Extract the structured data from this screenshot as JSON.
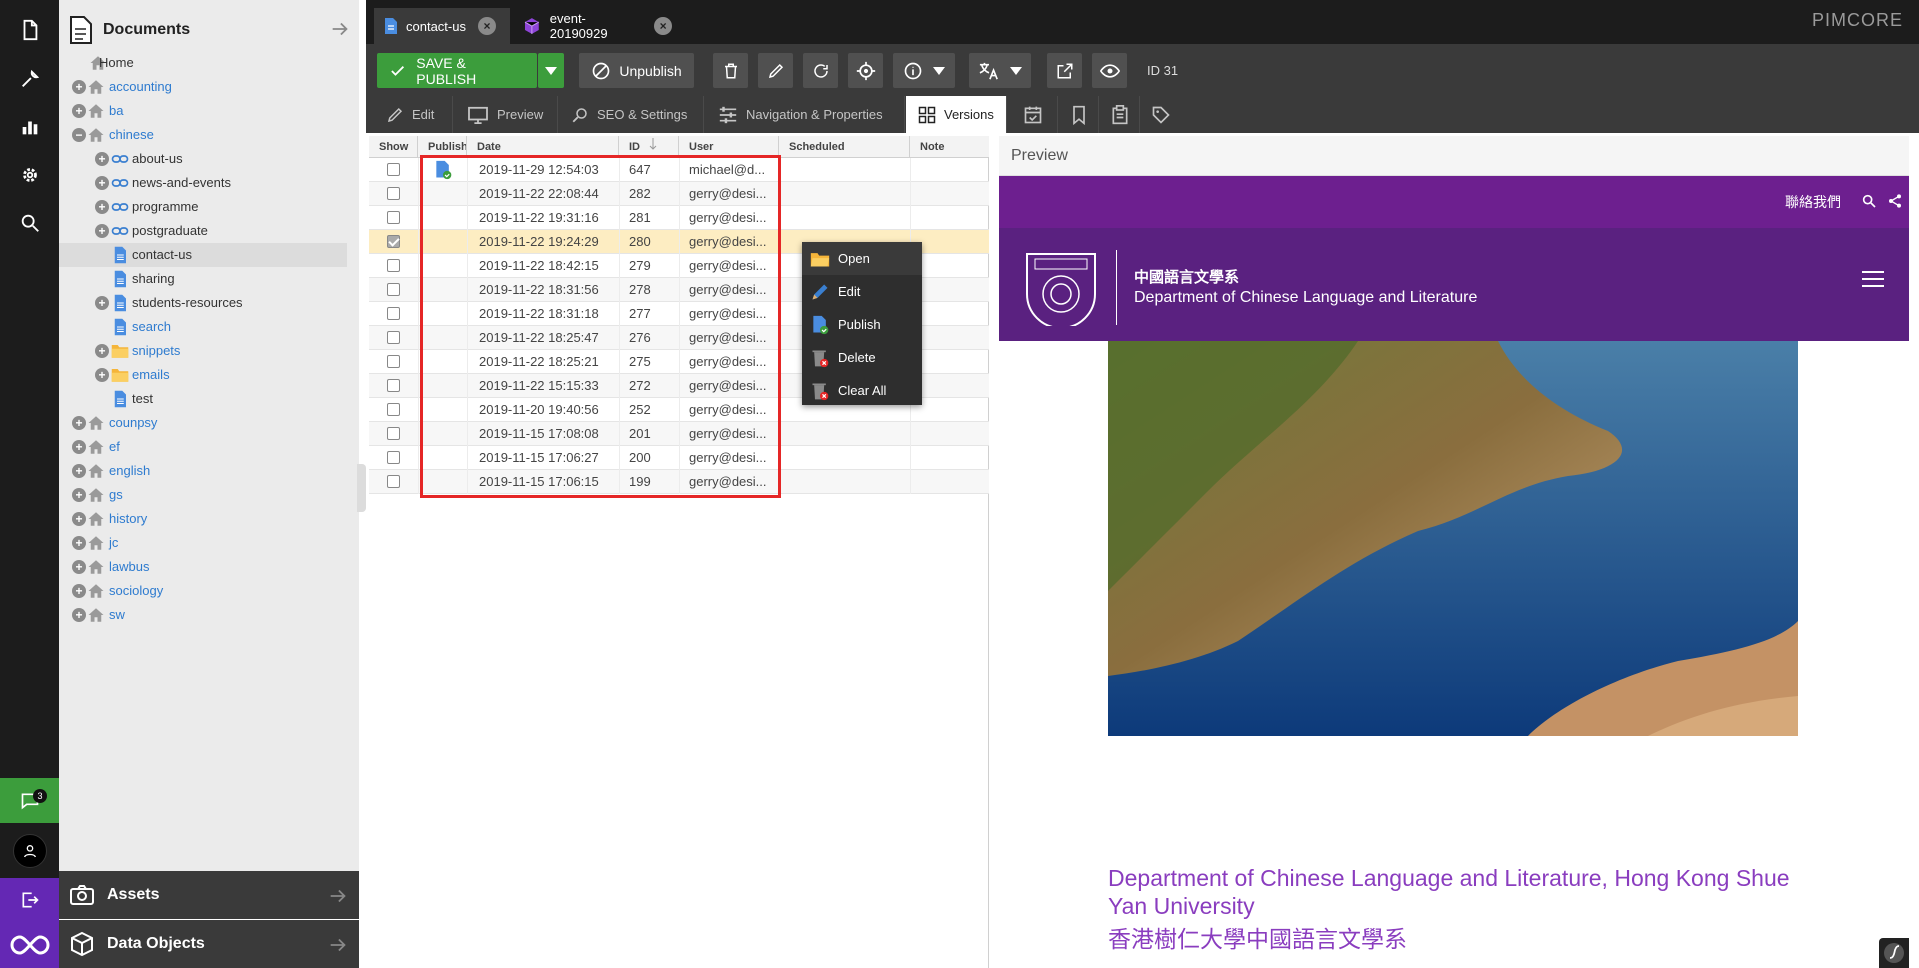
{
  "app": {
    "brand": "PIMCORE"
  },
  "rail": {
    "icons": [
      "file-icon",
      "tools-icon",
      "chart-icon",
      "gear-icon",
      "search-icon"
    ],
    "chat_count": "3"
  },
  "tree": {
    "title": "Documents",
    "items": [
      {
        "label": "Home",
        "depth": 0,
        "icon": "home",
        "toggle": "none",
        "style": "dark"
      },
      {
        "label": "accounting",
        "depth": 1,
        "icon": "home",
        "toggle": "plus",
        "style": "link"
      },
      {
        "label": "ba",
        "depth": 1,
        "icon": "home",
        "toggle": "plus",
        "style": "link"
      },
      {
        "label": "chinese",
        "depth": 1,
        "icon": "home",
        "toggle": "minus",
        "style": "link"
      },
      {
        "label": "about-us",
        "depth": 2,
        "icon": "link",
        "toggle": "plus",
        "style": "dark"
      },
      {
        "label": "news-and-events",
        "depth": 2,
        "icon": "link",
        "toggle": "plus",
        "style": "dark"
      },
      {
        "label": "programme",
        "depth": 2,
        "icon": "link",
        "toggle": "plus",
        "style": "dark"
      },
      {
        "label": "postgraduate",
        "depth": 2,
        "icon": "link",
        "toggle": "plus",
        "style": "dark"
      },
      {
        "label": "contact-us",
        "depth": 2,
        "icon": "page",
        "toggle": "none",
        "style": "dark",
        "selected": true
      },
      {
        "label": "sharing",
        "depth": 2,
        "icon": "page",
        "toggle": "none",
        "style": "dark"
      },
      {
        "label": "students-resources",
        "depth": 2,
        "icon": "page",
        "toggle": "plus",
        "style": "dark"
      },
      {
        "label": "search",
        "depth": 2,
        "icon": "page",
        "toggle": "none",
        "style": "link"
      },
      {
        "label": "snippets",
        "depth": 2,
        "icon": "folder",
        "toggle": "plus",
        "style": "link"
      },
      {
        "label": "emails",
        "depth": 2,
        "icon": "folder",
        "toggle": "plus",
        "style": "link"
      },
      {
        "label": "test",
        "depth": 2,
        "icon": "page",
        "toggle": "none",
        "style": "dark"
      },
      {
        "label": "counpsy",
        "depth": 1,
        "icon": "home",
        "toggle": "plus",
        "style": "link"
      },
      {
        "label": "ef",
        "depth": 1,
        "icon": "home",
        "toggle": "plus",
        "style": "link"
      },
      {
        "label": "english",
        "depth": 1,
        "icon": "home",
        "toggle": "plus",
        "style": "link"
      },
      {
        "label": "gs",
        "depth": 1,
        "icon": "home",
        "toggle": "plus",
        "style": "link"
      },
      {
        "label": "history",
        "depth": 1,
        "icon": "home",
        "toggle": "plus",
        "style": "link"
      },
      {
        "label": "jc",
        "depth": 1,
        "icon": "home",
        "toggle": "plus",
        "style": "link"
      },
      {
        "label": "lawbus",
        "depth": 1,
        "icon": "home",
        "toggle": "plus",
        "style": "link"
      },
      {
        "label": "sociology",
        "depth": 1,
        "icon": "home",
        "toggle": "plus",
        "style": "link"
      },
      {
        "label": "sw",
        "depth": 1,
        "icon": "home",
        "toggle": "plus",
        "style": "link"
      }
    ]
  },
  "bottom_panels": {
    "assets": "Assets",
    "data_objects": "Data Objects"
  },
  "tabs": [
    {
      "label": "contact-us",
      "active": true
    },
    {
      "label": "event-20190929",
      "active": false
    }
  ],
  "toolbar": {
    "save_publish": "SAVE & PUBLISH",
    "unpublish": "Unpublish",
    "doc_id": "ID 31"
  },
  "subtabs": [
    {
      "label": "Edit",
      "icon": "pencil-icon"
    },
    {
      "label": "Preview",
      "icon": "monitor-icon"
    },
    {
      "label": "SEO & Settings",
      "icon": "seo-search-icon"
    },
    {
      "label": "Navigation & Properties",
      "icon": "sliders-icon"
    },
    {
      "label": "Versions",
      "icon": "grid-icon",
      "active": true
    }
  ],
  "versions": {
    "columns": [
      "Show",
      "Publish",
      "Date",
      "ID",
      "User",
      "Scheduled",
      "Note"
    ],
    "rows": [
      {
        "show": false,
        "published": true,
        "date": "2019-11-29 12:54:03",
        "id": "647",
        "user": "michael@d..."
      },
      {
        "show": false,
        "published": false,
        "date": "2019-11-22 22:08:44",
        "id": "282",
        "user": "gerry@desi..."
      },
      {
        "show": false,
        "published": false,
        "date": "2019-11-22 19:31:16",
        "id": "281",
        "user": "gerry@desi..."
      },
      {
        "show": true,
        "published": false,
        "date": "2019-11-22 19:24:29",
        "id": "280",
        "user": "gerry@desi...",
        "highlight": true
      },
      {
        "show": false,
        "published": false,
        "date": "2019-11-22 18:42:15",
        "id": "279",
        "user": "gerry@desi..."
      },
      {
        "show": false,
        "published": false,
        "date": "2019-11-22 18:31:56",
        "id": "278",
        "user": "gerry@desi..."
      },
      {
        "show": false,
        "published": false,
        "date": "2019-11-22 18:31:18",
        "id": "277",
        "user": "gerry@desi..."
      },
      {
        "show": false,
        "published": false,
        "date": "2019-11-22 18:25:47",
        "id": "276",
        "user": "gerry@desi..."
      },
      {
        "show": false,
        "published": false,
        "date": "2019-11-22 18:25:21",
        "id": "275",
        "user": "gerry@desi..."
      },
      {
        "show": false,
        "published": false,
        "date": "2019-11-22 15:15:33",
        "id": "272",
        "user": "gerry@desi..."
      },
      {
        "show": false,
        "published": false,
        "date": "2019-11-20 19:40:56",
        "id": "252",
        "user": "gerry@desi..."
      },
      {
        "show": false,
        "published": false,
        "date": "2019-11-15 17:08:08",
        "id": "201",
        "user": "gerry@desi..."
      },
      {
        "show": false,
        "published": false,
        "date": "2019-11-15 17:06:27",
        "id": "200",
        "user": "gerry@desi..."
      },
      {
        "show": false,
        "published": false,
        "date": "2019-11-15 17:06:15",
        "id": "199",
        "user": "gerry@desi..."
      }
    ]
  },
  "context_menu": [
    {
      "label": "Open",
      "icon": "open-folder-icon"
    },
    {
      "label": "Edit",
      "icon": "pencil-icon"
    },
    {
      "label": "Publish",
      "icon": "publish-icon"
    },
    {
      "label": "Delete",
      "icon": "delete-icon"
    },
    {
      "label": "Clear All",
      "icon": "clear-all-icon"
    }
  ],
  "preview": {
    "title": "Preview",
    "contact_link": "聯絡我們",
    "site_name_cn": "中國語言文學系",
    "site_name_en": "Department of Chinese Language and Literature",
    "heading_en": "Department of Chinese Language and Literature, Hong Kong Shue Yan University",
    "heading_cn": "香港樹仁大學中國語言文學系"
  },
  "colors": {
    "accent_green": "#3c9d3c",
    "pimcore_purple": "#6428b4",
    "site_purple": "#6d1f8f",
    "highlight_red": "#e52626"
  }
}
